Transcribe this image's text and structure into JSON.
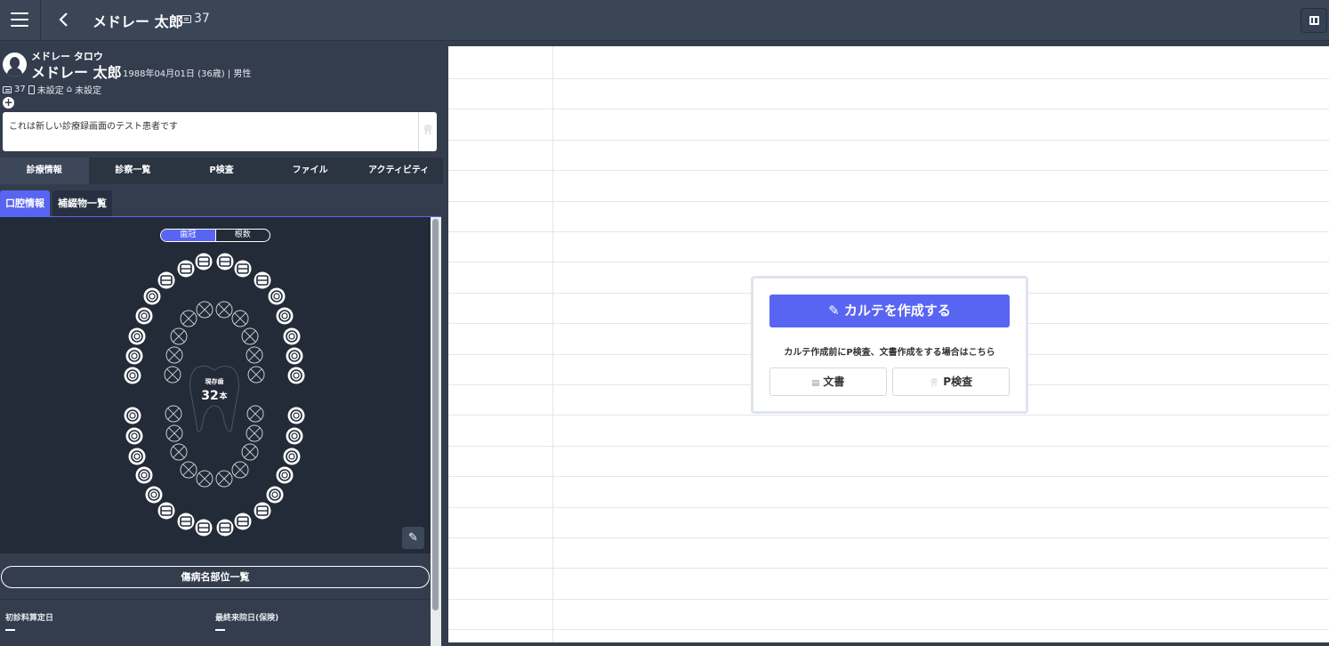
{
  "header": {
    "title": "メドレー 太郎",
    "patient_id": "37"
  },
  "patient": {
    "kana": "メドレー タロウ",
    "name": "メドレー 太郎",
    "info": "1988年04月01日 (36歳) | 男性",
    "id": "37",
    "phone": "未設定",
    "home": "未設定",
    "memo": "これは新しい診療録画面のテスト患者です"
  },
  "tabs": [
    {
      "label": "診療情報",
      "active": true
    },
    {
      "label": "診察一覧",
      "active": false
    },
    {
      "label": "P検査",
      "active": false
    },
    {
      "label": "ファイル",
      "active": false
    },
    {
      "label": "アクティビティ",
      "active": false
    }
  ],
  "subtabs": [
    {
      "label": "口腔情報",
      "active": true
    },
    {
      "label": "補綴物一覧",
      "active": false
    }
  ],
  "dental_chart": {
    "toggle": [
      "歯冠",
      "根数"
    ],
    "existing_label": "現存歯",
    "existing_count": "32",
    "existing_unit": "本"
  },
  "disease_button": "傷病名部位一覧",
  "info_fields": [
    {
      "label": "初診料算定日",
      "value": "—"
    },
    {
      "label": "最終来院日(保険)",
      "value": "—"
    }
  ],
  "card": {
    "create_label": "カルテを作成する",
    "hint": "カルテ作成前にP検査、文書作成をする場合はこちら",
    "doc_label": "文書",
    "pexam_label": "P検査"
  },
  "colors": {
    "accent": "#5865f2",
    "sidebar": "#333d4d",
    "chart_bg": "#232b38"
  }
}
